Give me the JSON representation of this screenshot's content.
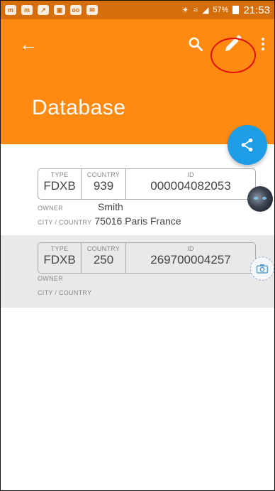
{
  "status_bar": {
    "left_icons": [
      "app-notification-icon",
      "app-notification-icon",
      "wifi-share-icon",
      "image-icon",
      "voicemail-icon",
      "mail-icon"
    ],
    "battery": "57%",
    "time": "21:53"
  },
  "app_bar": {
    "title": "Database",
    "color": "#ff8a12",
    "actions": [
      "back-arrow-icon",
      "search-icon",
      "edit-icon",
      "more-vert-icon"
    ]
  },
  "fab": {
    "icon": "share-icon",
    "color": "#1e9de6"
  },
  "labels": {
    "type": "TYPE",
    "country": "COUNTRY",
    "id": "ID",
    "owner": "OWNER",
    "city_country": "CITY / COUNTRY"
  },
  "records": [
    {
      "type": "FDXB",
      "country": "939",
      "id": "000004082053",
      "owner": "Smith",
      "city_country": "75016 Paris France",
      "thumbnail": "cat-photo"
    },
    {
      "type": "FDXB",
      "country": "250",
      "id": "269700004257",
      "owner": "",
      "city_country": "",
      "thumbnail": "camera-icon"
    }
  ]
}
